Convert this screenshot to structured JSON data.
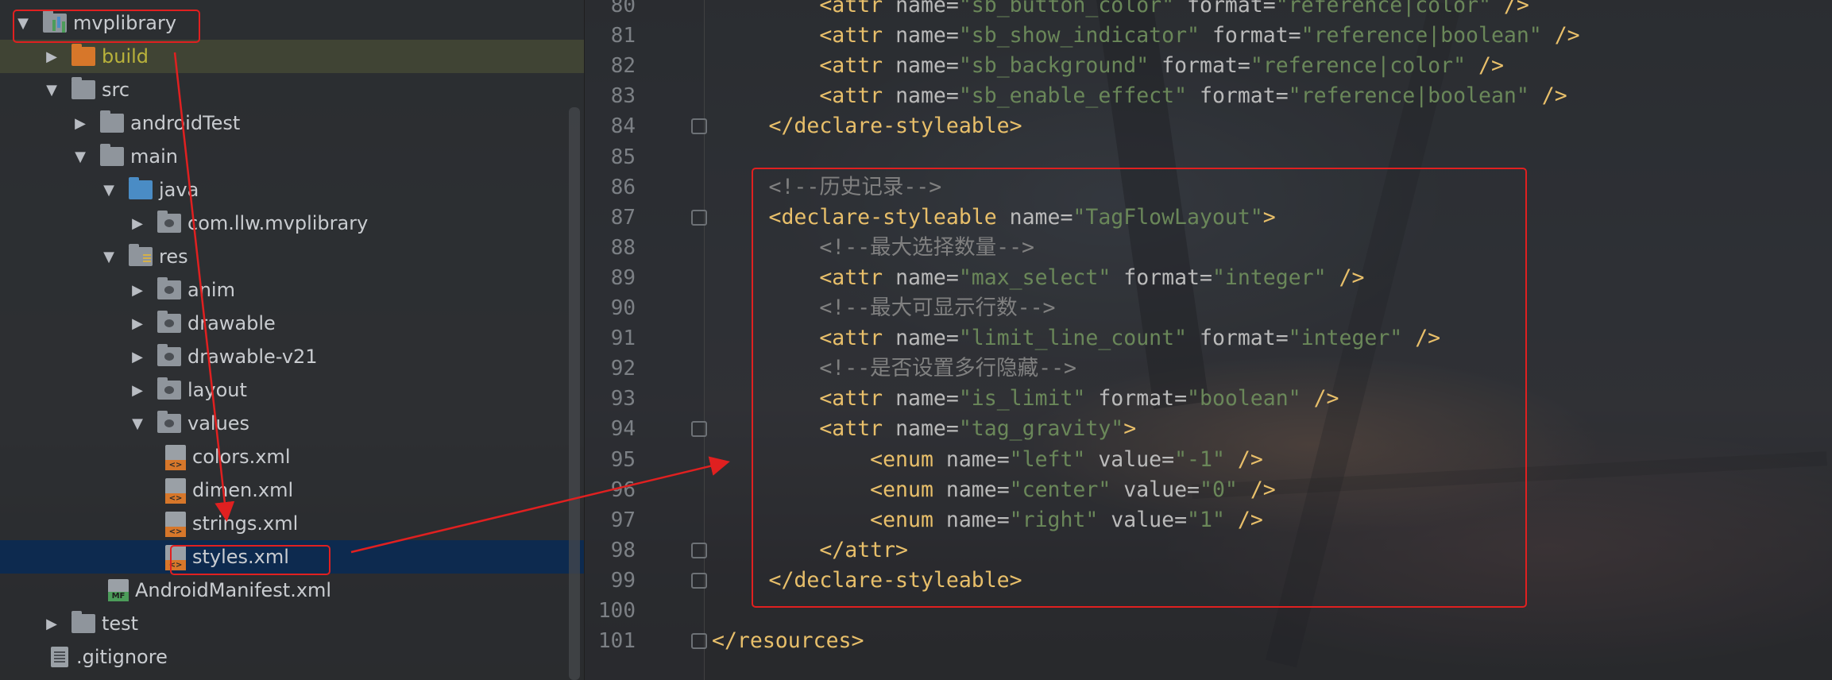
{
  "project_tree": {
    "items": [
      {
        "label": "mvplibrary",
        "expanded": true,
        "icon": "module-icon"
      },
      {
        "label": "build",
        "expanded": false,
        "icon": "folder-orange-icon"
      },
      {
        "label": "src",
        "expanded": true,
        "icon": "folder-icon"
      },
      {
        "label": "androidTest",
        "expanded": false,
        "icon": "folder-icon"
      },
      {
        "label": "main",
        "expanded": true,
        "icon": "folder-icon"
      },
      {
        "label": "java",
        "expanded": true,
        "icon": "folder-blue-icon"
      },
      {
        "label": "com.llw.mvplibrary",
        "expanded": false,
        "icon": "package-icon"
      },
      {
        "label": "res",
        "expanded": true,
        "icon": "resource-folder-icon"
      },
      {
        "label": "anim",
        "expanded": false,
        "icon": "package-icon"
      },
      {
        "label": "drawable",
        "expanded": false,
        "icon": "package-icon"
      },
      {
        "label": "drawable-v21",
        "expanded": false,
        "icon": "package-icon"
      },
      {
        "label": "layout",
        "expanded": false,
        "icon": "package-icon"
      },
      {
        "label": "values",
        "expanded": true,
        "icon": "package-icon"
      },
      {
        "label": "colors.xml",
        "icon": "xml-file-icon"
      },
      {
        "label": "dimen.xml",
        "icon": "xml-file-icon"
      },
      {
        "label": "strings.xml",
        "icon": "xml-file-icon"
      },
      {
        "label": "styles.xml",
        "icon": "xml-file-icon",
        "selected": true
      },
      {
        "label": "AndroidManifest.xml",
        "icon": "manifest-file-icon"
      },
      {
        "label": "test",
        "expanded": false,
        "icon": "folder-icon"
      },
      {
        "label": ".gitignore",
        "icon": "text-file-icon"
      }
    ]
  },
  "editor": {
    "lines": [
      {
        "num": "80",
        "parts": [
          [
            "p",
            "    "
          ],
          [
            "t",
            "<attr "
          ],
          [
            "a",
            "name="
          ],
          [
            "v",
            "\"sb_button_color\""
          ],
          [
            "a",
            " format="
          ],
          [
            "v",
            "\"reference|color\""
          ],
          [
            "t",
            " />"
          ]
        ]
      },
      {
        "num": "81",
        "parts": [
          [
            "p",
            "    "
          ],
          [
            "t",
            "<attr "
          ],
          [
            "a",
            "name="
          ],
          [
            "v",
            "\"sb_show_indicator\""
          ],
          [
            "a",
            " format="
          ],
          [
            "v",
            "\"reference|boolean\""
          ],
          [
            "t",
            " />"
          ]
        ]
      },
      {
        "num": "82",
        "parts": [
          [
            "p",
            "    "
          ],
          [
            "t",
            "<attr "
          ],
          [
            "a",
            "name="
          ],
          [
            "v",
            "\"sb_background\""
          ],
          [
            "a",
            " format="
          ],
          [
            "v",
            "\"reference|color\""
          ],
          [
            "t",
            " />"
          ]
        ]
      },
      {
        "num": "83",
        "parts": [
          [
            "p",
            "    "
          ],
          [
            "t",
            "<attr "
          ],
          [
            "a",
            "name="
          ],
          [
            "v",
            "\"sb_enable_effect\""
          ],
          [
            "a",
            " format="
          ],
          [
            "v",
            "\"reference|boolean\""
          ],
          [
            "t",
            " />"
          ]
        ]
      },
      {
        "num": "84",
        "parts": [
          [
            "t",
            "</declare-styleable>"
          ]
        ]
      },
      {
        "num": "85",
        "parts": []
      },
      {
        "num": "86",
        "parts": [
          [
            "c",
            "<!--历史记录-->"
          ]
        ]
      },
      {
        "num": "87",
        "parts": [
          [
            "t",
            "<declare-styleable "
          ],
          [
            "a",
            "name="
          ],
          [
            "v",
            "\"TagFlowLayout\""
          ],
          [
            "t",
            ">"
          ]
        ]
      },
      {
        "num": "88",
        "parts": [
          [
            "p",
            "    "
          ],
          [
            "c",
            "<!--最大选择数量-->"
          ]
        ]
      },
      {
        "num": "89",
        "parts": [
          [
            "p",
            "    "
          ],
          [
            "t",
            "<attr "
          ],
          [
            "a",
            "name="
          ],
          [
            "v",
            "\"max_select\""
          ],
          [
            "a",
            " format="
          ],
          [
            "v",
            "\"integer\""
          ],
          [
            "t",
            " />"
          ]
        ]
      },
      {
        "num": "90",
        "parts": [
          [
            "p",
            "    "
          ],
          [
            "c",
            "<!--最大可显示行数-->"
          ]
        ]
      },
      {
        "num": "91",
        "parts": [
          [
            "p",
            "    "
          ],
          [
            "t",
            "<attr "
          ],
          [
            "a",
            "name="
          ],
          [
            "v",
            "\"limit_line_count\""
          ],
          [
            "a",
            " format="
          ],
          [
            "v",
            "\"integer\""
          ],
          [
            "t",
            " />"
          ]
        ]
      },
      {
        "num": "92",
        "parts": [
          [
            "p",
            "    "
          ],
          [
            "c",
            "<!--是否设置多行隐藏-->"
          ]
        ]
      },
      {
        "num": "93",
        "parts": [
          [
            "p",
            "    "
          ],
          [
            "t",
            "<attr "
          ],
          [
            "a",
            "name="
          ],
          [
            "v",
            "\"is_limit\""
          ],
          [
            "a",
            " format="
          ],
          [
            "v",
            "\"boolean\""
          ],
          [
            "t",
            " />"
          ]
        ]
      },
      {
        "num": "94",
        "parts": [
          [
            "p",
            "    "
          ],
          [
            "t",
            "<attr "
          ],
          [
            "a",
            "name="
          ],
          [
            "v",
            "\"tag_gravity\""
          ],
          [
            "t",
            ">"
          ]
        ]
      },
      {
        "num": "95",
        "parts": [
          [
            "p",
            "        "
          ],
          [
            "t",
            "<enum "
          ],
          [
            "a",
            "name="
          ],
          [
            "v",
            "\"left\""
          ],
          [
            "a",
            " value="
          ],
          [
            "v",
            "\"-1\""
          ],
          [
            "t",
            " />"
          ]
        ]
      },
      {
        "num": "96",
        "parts": [
          [
            "p",
            "        "
          ],
          [
            "t",
            "<enum "
          ],
          [
            "a",
            "name="
          ],
          [
            "v",
            "\"center\""
          ],
          [
            "a",
            " value="
          ],
          [
            "v",
            "\"0\""
          ],
          [
            "t",
            " />"
          ]
        ]
      },
      {
        "num": "97",
        "parts": [
          [
            "p",
            "        "
          ],
          [
            "t",
            "<enum "
          ],
          [
            "a",
            "name="
          ],
          [
            "v",
            "\"right\""
          ],
          [
            "a",
            " value="
          ],
          [
            "v",
            "\"1\""
          ],
          [
            "t",
            " />"
          ]
        ]
      },
      {
        "num": "98",
        "parts": [
          [
            "p",
            "    "
          ],
          [
            "t",
            "</attr>"
          ]
        ]
      },
      {
        "num": "99",
        "parts": [
          [
            "t",
            "</declare-styleable>"
          ]
        ]
      },
      {
        "num": "100",
        "parts": []
      },
      {
        "num": "101",
        "parts": [
          [
            "t",
            "</resources>"
          ]
        ]
      }
    ]
  },
  "colors": {
    "annotation_red": "#e02020",
    "selection_blue": "#0d2a4f",
    "xml_tag": "#e8bf6a",
    "xml_value": "#6a8759",
    "xml_comment": "#808080"
  }
}
